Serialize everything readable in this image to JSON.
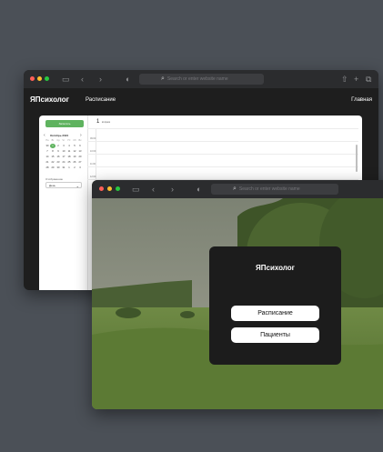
{
  "browser": {
    "address_placeholder": "Search or enter website name"
  },
  "back_window": {
    "brand": "ЯПсихолог",
    "nav_link": "Расписание",
    "home_link": "Главная",
    "add_button": "Записать",
    "month_title": "Октябрь 2024",
    "weekdays": [
      "Пн",
      "Вт",
      "Ср",
      "Чт",
      "Пт",
      "Сб",
      "Вс"
    ],
    "calendar_rows": [
      [
        "30",
        "1",
        "2",
        "3",
        "4",
        "5",
        "6"
      ],
      [
        "7",
        "8",
        "9",
        "10",
        "11",
        "12",
        "13"
      ],
      [
        "14",
        "15",
        "16",
        "17",
        "18",
        "19",
        "20"
      ],
      [
        "21",
        "22",
        "23",
        "24",
        "25",
        "26",
        "27"
      ],
      [
        "28",
        "29",
        "30",
        "31",
        "1",
        "2",
        "3"
      ]
    ],
    "select_label": "Отображение",
    "select_value": "День",
    "day_number": "1",
    "day_name": "вторник",
    "time_labels": [
      "09:00",
      "10:00",
      "11:00",
      "12:00"
    ]
  },
  "front_window": {
    "card_title": "ЯПсихолог",
    "button_schedule": "Расписание",
    "button_patients": "Пациенты"
  },
  "colors": {
    "desktop": "#4b5057",
    "accent_green": "#5fb35f",
    "dot_red": "#ff5f57",
    "dot_yellow": "#febc2e",
    "dot_green": "#28c840"
  }
}
